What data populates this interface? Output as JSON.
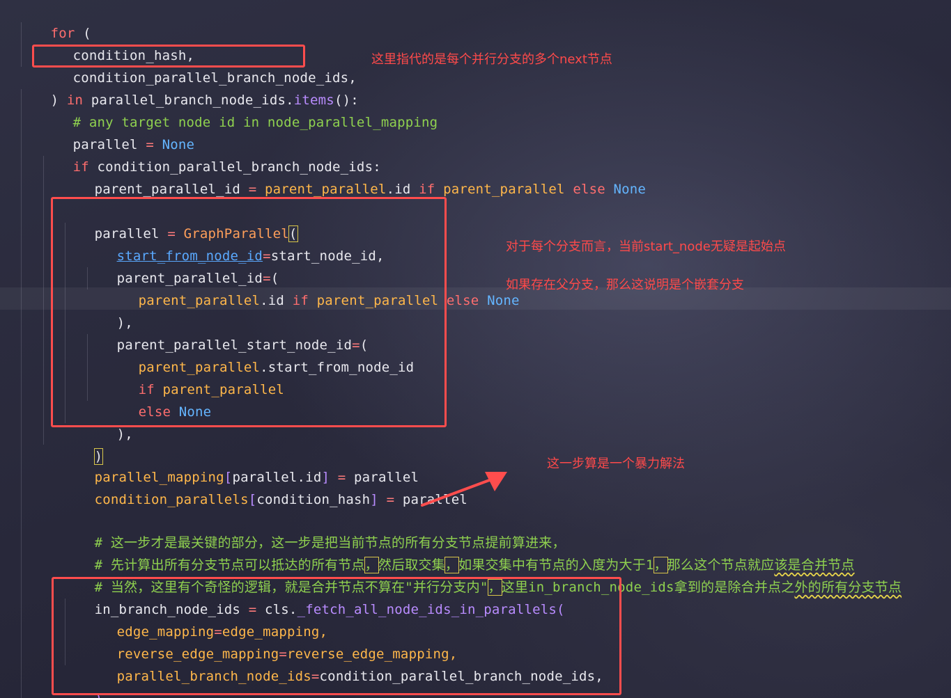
{
  "code": {
    "line1": {
      "kw_for": "for",
      "paren": "("
    },
    "line2": {
      "text": "condition_hash,"
    },
    "line3": {
      "text": "condition_parallel_branch_node_ids,"
    },
    "line4": {
      "close": ")",
      "kw_in": "in",
      "obj": "parallel_branch_node_ids",
      "dot": ".",
      "method": "items",
      "call": "():"
    },
    "line5": {
      "comment": "# any target node id in node_parallel_mapping"
    },
    "line6": {
      "var": "parallel",
      "eq": "=",
      "none": "None"
    },
    "line7": {
      "kw_if": "if",
      "cond": "condition_parallel_branch_node_ids:"
    },
    "line8": {
      "var": "parent_parallel_id",
      "eq": "=",
      "obj": "parent_parallel",
      "attr": ".id",
      "kw_if": "if",
      "cond": "parent_parallel",
      "kw_else": "else",
      "none": "None"
    },
    "line10": {
      "var": "parallel",
      "eq": "=",
      "cls": "GraphParallel",
      "paren": "("
    },
    "line11": {
      "kwarg": "start_from_node_id",
      "eq": "=",
      "val": "start_node_id,"
    },
    "line12": {
      "kwarg": "parent_parallel_id",
      "eq": "=",
      "paren": "("
    },
    "line13": {
      "obj": "parent_parallel",
      "attr": ".id",
      "kw_if": "if",
      "cond": "parent_parallel",
      "kw_else": "else",
      "none": "None"
    },
    "line14": {
      "close": "),"
    },
    "line15": {
      "kwarg": "parent_parallel_start_node_id",
      "eq": "=",
      "paren": "("
    },
    "line16": {
      "obj": "parent_parallel",
      "attr": ".start_from_node_id"
    },
    "line17": {
      "kw_if": "if",
      "cond": "parent_parallel"
    },
    "line18": {
      "kw_else": "else",
      "none": "None"
    },
    "line19": {
      "close": "),"
    },
    "line20": {
      "close": ")"
    },
    "line21": {
      "obj": "parallel_mapping",
      "lb": "[",
      "key": "parallel.id",
      "rb": "]",
      "eq": "=",
      "val": "parallel"
    },
    "line22": {
      "obj": "condition_parallels",
      "lb": "[",
      "key": "condition_hash",
      "rb": "]",
      "eq": "=",
      "val": "parallel"
    },
    "line24": {
      "comment": "# 这一步才是最关键的部分，这一步是把当前节点的所有分支节点提前算进来，"
    },
    "line25": {
      "c1": "# 先计算出所有分支节点可以抵达的所有节点",
      "m1": "，",
      "c2": "然后取交集",
      "m2": "，",
      "c3": "如果交集中有节点的入度为大于1",
      "m3": "，",
      "c4": "那么这个节点就应",
      "w1": "该是合并节点"
    },
    "line26": {
      "c1": "# 当然，这里有个奇怪的逻辑，就是合并节点不算在\"并行分支内\"",
      "m1": "，",
      "c2": "这里in_branch_node_ids拿到的是除合并点之",
      "w1": "外的所有分支节点"
    },
    "line27": {
      "var": "in_branch_node_ids",
      "eq": "=",
      "obj": "cls.",
      "method": "_fetch_all_node_ids_in_parallels",
      "paren": "("
    },
    "line28": {
      "kwarg": "edge_mapping",
      "eq": "=",
      "val": "edge_mapping,"
    },
    "line29": {
      "kwarg": "reverse_edge_mapping",
      "eq": "=",
      "val": "reverse_edge_mapping,"
    },
    "line30": {
      "kwarg": "parallel_branch_node_ids",
      "eq": "=",
      "val": "condition_parallel_branch_node_ids,"
    },
    "line31": {
      "close": ")"
    }
  },
  "annotations": {
    "note1": "这里指代的是每个并行分支的多个next节点",
    "note2": "对于每个分支而言，当前start_node无疑是起始点",
    "note3": "如果存在父分支，那么这说明是个嵌套分支",
    "note4": "这一步算是一个暴力解法"
  },
  "colors": {
    "annotation": "#ff4a4a",
    "keyword": "#ff6e6e",
    "comment": "#8fd14f",
    "constant": "#64b5ff",
    "attribute": "#ffb74a"
  }
}
